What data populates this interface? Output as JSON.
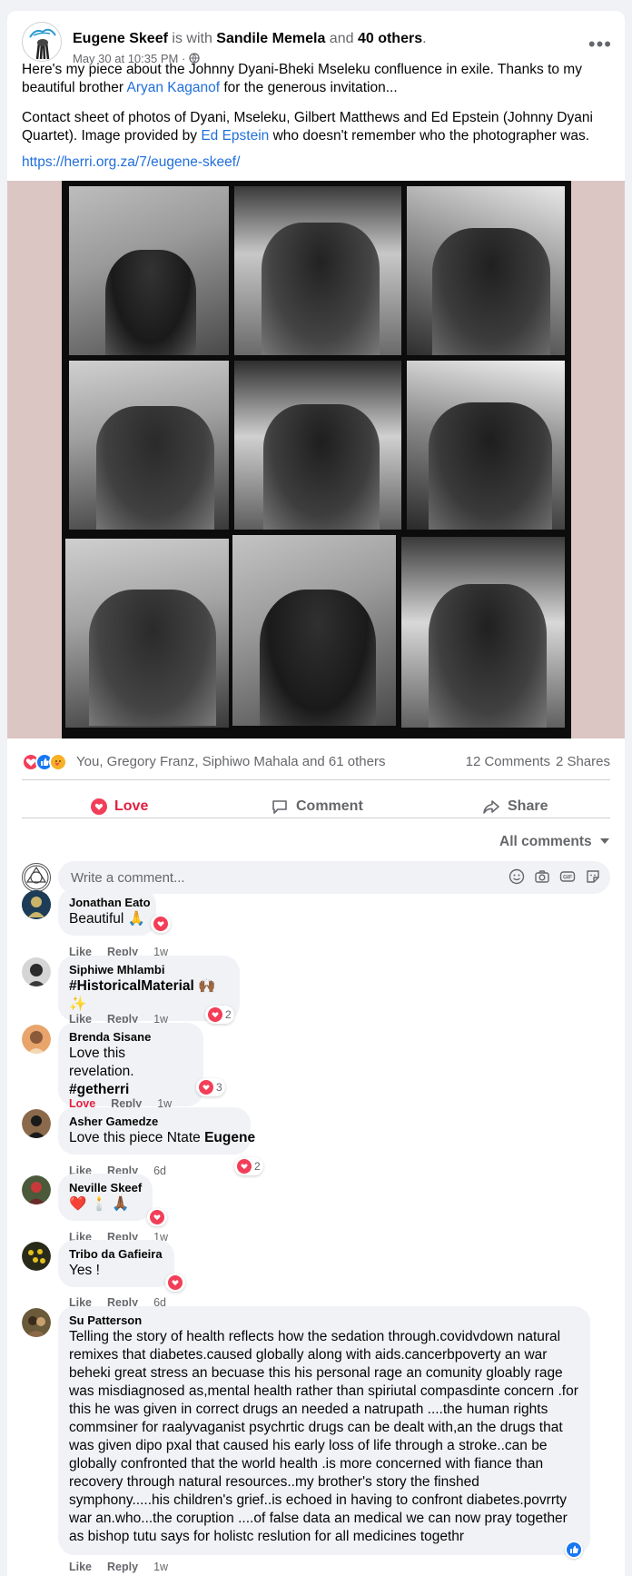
{
  "post": {
    "author": "Eugene Skeef",
    "with_text": "is with",
    "tagged_person": "Sandile Memela",
    "and_text": "and",
    "others": "40 others",
    "timestamp": "May 30 at 10:35 PM",
    "separator": "·",
    "paragraph1_pre": "Here's my piece about the Johnny Dyani-Bheki Mseleku confluence in exile. Thanks to my beautiful brother",
    "paragraph1_link": "Aryan Kaganof",
    "paragraph1_post": "for the generous invitation...",
    "paragraph2_pre": "Contact sheet of photos of Dyani, Mseleku, Gilbert Matthews and Ed Epstein (Johnny Dyani Quartet). Image provided by",
    "paragraph2_link": "Ed Epstein",
    "paragraph2_post": "who doesn't remember who the photographer was.",
    "url": "https://herri.org.za/7/eugene-skeef/"
  },
  "reactions": {
    "names": "You, Gregory Franz, Siphiwo Mahala and 61 others",
    "comments": "12 Comments",
    "shares": "2 Shares",
    "colors": {
      "love": "#f33e58",
      "like": "#1877f2",
      "care": "#f7b125"
    }
  },
  "actions": {
    "love": "Love",
    "comment": "Comment",
    "share": "Share",
    "love_color": "#e41e3f"
  },
  "comment_filter": "All comments",
  "composer": {
    "placeholder": "Write a comment..."
  },
  "comments": [
    {
      "name": "Jonathan Eato",
      "text": "Beautiful 🙏",
      "like": "Like",
      "reply": "Reply",
      "time": "1w",
      "count": ""
    },
    {
      "name": "Siphiwe Mhlambi",
      "text": "#HistoricalMaterial 🙌🏾✨",
      "like": "Like",
      "reply": "Reply",
      "time": "1w",
      "count": "2"
    },
    {
      "name": "Brenda Sisane",
      "text": "Love this revelation.",
      "text2": "#getherri",
      "like": "Love",
      "reply": "Reply",
      "time": "1w",
      "count": "3"
    },
    {
      "name": "Asher Gamedze",
      "text_pre": "Love this piece Ntate",
      "text_bold": "Eugene",
      "like": "Like",
      "reply": "Reply",
      "time": "6d",
      "count": "2"
    },
    {
      "name": "Neville Skeef",
      "text": "❤️ 🕯️ 🙏🏾",
      "like": "Like",
      "reply": "Reply",
      "time": "1w",
      "count": ""
    },
    {
      "name": "Tribo da Gafieira",
      "text": "Yes !",
      "like": "Like",
      "reply": "Reply",
      "time": "6d",
      "count": ""
    },
    {
      "name": "Su Patterson",
      "text": "Telling the story of health reflects how the sedation through.covidvdown natural remixes that diabetes.caused globally along with aids.cancerbpoverty an war beheki great stress an becuase this his personal rage an comunity gloably rage was misdiagnosed as,mental health rather than spiriutal compasdinte concern .for this he was given in correct drugs an needed a natrupath ....the human rights commsiner for raalyvaganist psychrtic drugs can be dealt with,an the drugs that was given dipo pxal that caused his early loss of life through a stroke..can be globally confronted that the world health .is more concerned with fiance than recovery through natural resources..my brother's story the finshed symphony.....his children's grief..is echoed in having to confront diabetes.povrrty war an.who...the coruption ....of false data an medical we can now pray together as bishop tutu says for holistc reslution for all medicines togethr",
      "like": "Like",
      "reply": "Reply",
      "time": "1w",
      "count": ""
    }
  ]
}
